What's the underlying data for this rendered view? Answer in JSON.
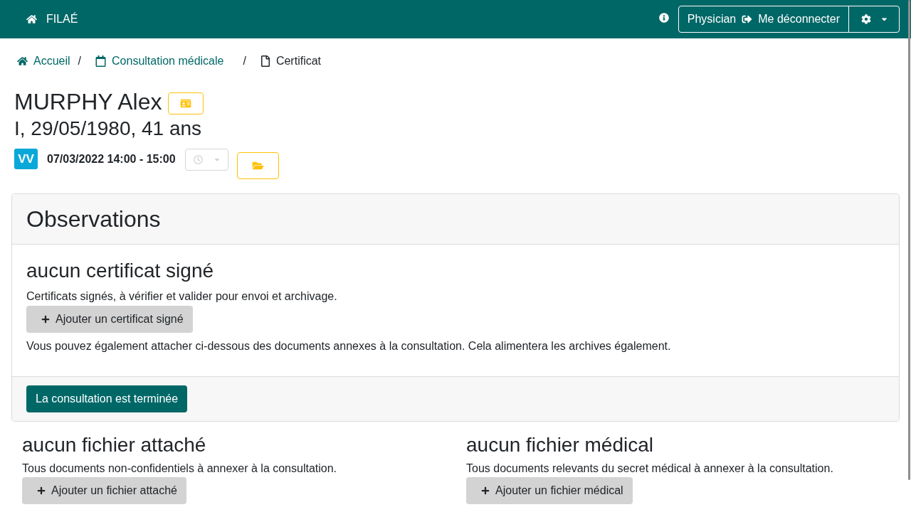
{
  "navbar": {
    "brand": "FILAÉ",
    "user": "Physician",
    "logout": "Me déconnecter"
  },
  "breadcrumb": [
    {
      "kind": "home",
      "label": "Accueil",
      "current": false,
      "separator": "/"
    },
    {
      "kind": "calendar",
      "label": "Consultation médicale",
      "current": false,
      "separator": "/"
    },
    {
      "kind": "document",
      "label": "Certificat",
      "current": true
    }
  ],
  "patient": {
    "name": "MURPHY Alex",
    "details": "I, 29/05/1980, 41 ans"
  },
  "appointment": {
    "initials": "VV",
    "time": "07/03/2022 14:00 - 15:00",
    "status_menu": {
      "disabled": true
    }
  },
  "observations": {
    "title": "Observations",
    "heading": "aucun certificat signé",
    "description": "Certificats signés, à vérifier et valider pour envoi et archivage.",
    "add_button": "Ajouter un certificat signé",
    "note": "Vous pouvez également attacher ci-dessous des documents annexes à la consultation. Cela alimentera les archives également.",
    "finish_button": "La consultation est terminée"
  },
  "file_sections": [
    {
      "heading": "aucun fichier attaché",
      "description": "Tous documents non-confidentiels à annexer à la consultation.",
      "add_button": "Ajouter un fichier attaché"
    },
    {
      "heading": "aucun fichier médical",
      "description": "Tous documents relevants du secret médical à annexer à la consultation.",
      "add_button": "Ajouter un fichier médical"
    }
  ]
}
